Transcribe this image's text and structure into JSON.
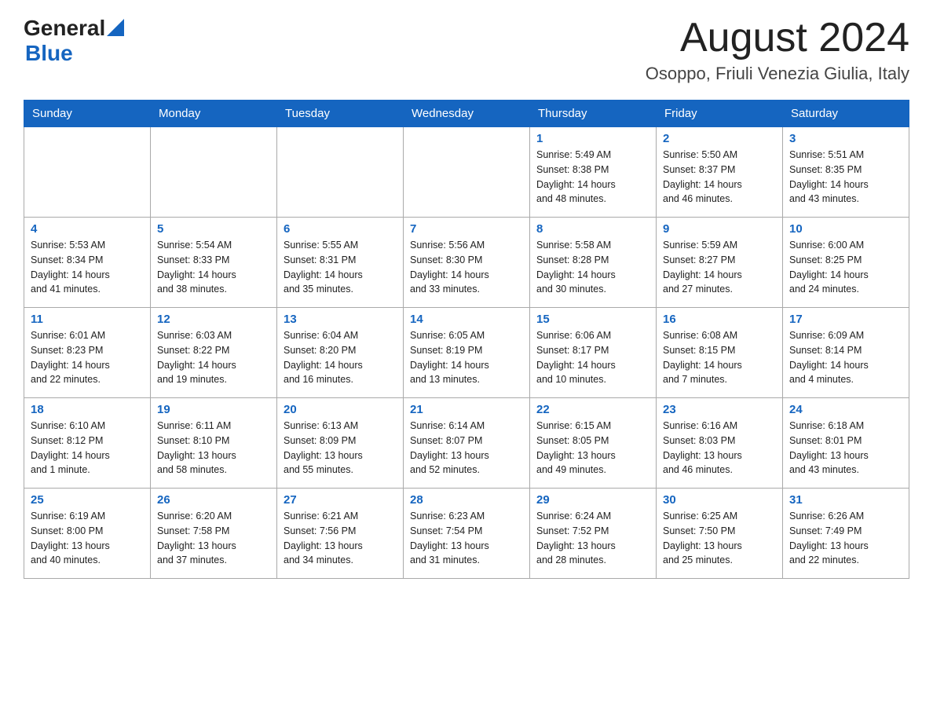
{
  "header": {
    "logo_general": "General",
    "logo_blue": "Blue",
    "month_title": "August 2024",
    "subtitle": "Osoppo, Friuli Venezia Giulia, Italy"
  },
  "days_of_week": [
    "Sunday",
    "Monday",
    "Tuesday",
    "Wednesday",
    "Thursday",
    "Friday",
    "Saturday"
  ],
  "weeks": [
    [
      {
        "day": "",
        "info": ""
      },
      {
        "day": "",
        "info": ""
      },
      {
        "day": "",
        "info": ""
      },
      {
        "day": "",
        "info": ""
      },
      {
        "day": "1",
        "info": "Sunrise: 5:49 AM\nSunset: 8:38 PM\nDaylight: 14 hours\nand 48 minutes."
      },
      {
        "day": "2",
        "info": "Sunrise: 5:50 AM\nSunset: 8:37 PM\nDaylight: 14 hours\nand 46 minutes."
      },
      {
        "day": "3",
        "info": "Sunrise: 5:51 AM\nSunset: 8:35 PM\nDaylight: 14 hours\nand 43 minutes."
      }
    ],
    [
      {
        "day": "4",
        "info": "Sunrise: 5:53 AM\nSunset: 8:34 PM\nDaylight: 14 hours\nand 41 minutes."
      },
      {
        "day": "5",
        "info": "Sunrise: 5:54 AM\nSunset: 8:33 PM\nDaylight: 14 hours\nand 38 minutes."
      },
      {
        "day": "6",
        "info": "Sunrise: 5:55 AM\nSunset: 8:31 PM\nDaylight: 14 hours\nand 35 minutes."
      },
      {
        "day": "7",
        "info": "Sunrise: 5:56 AM\nSunset: 8:30 PM\nDaylight: 14 hours\nand 33 minutes."
      },
      {
        "day": "8",
        "info": "Sunrise: 5:58 AM\nSunset: 8:28 PM\nDaylight: 14 hours\nand 30 minutes."
      },
      {
        "day": "9",
        "info": "Sunrise: 5:59 AM\nSunset: 8:27 PM\nDaylight: 14 hours\nand 27 minutes."
      },
      {
        "day": "10",
        "info": "Sunrise: 6:00 AM\nSunset: 8:25 PM\nDaylight: 14 hours\nand 24 minutes."
      }
    ],
    [
      {
        "day": "11",
        "info": "Sunrise: 6:01 AM\nSunset: 8:23 PM\nDaylight: 14 hours\nand 22 minutes."
      },
      {
        "day": "12",
        "info": "Sunrise: 6:03 AM\nSunset: 8:22 PM\nDaylight: 14 hours\nand 19 minutes."
      },
      {
        "day": "13",
        "info": "Sunrise: 6:04 AM\nSunset: 8:20 PM\nDaylight: 14 hours\nand 16 minutes."
      },
      {
        "day": "14",
        "info": "Sunrise: 6:05 AM\nSunset: 8:19 PM\nDaylight: 14 hours\nand 13 minutes."
      },
      {
        "day": "15",
        "info": "Sunrise: 6:06 AM\nSunset: 8:17 PM\nDaylight: 14 hours\nand 10 minutes."
      },
      {
        "day": "16",
        "info": "Sunrise: 6:08 AM\nSunset: 8:15 PM\nDaylight: 14 hours\nand 7 minutes."
      },
      {
        "day": "17",
        "info": "Sunrise: 6:09 AM\nSunset: 8:14 PM\nDaylight: 14 hours\nand 4 minutes."
      }
    ],
    [
      {
        "day": "18",
        "info": "Sunrise: 6:10 AM\nSunset: 8:12 PM\nDaylight: 14 hours\nand 1 minute."
      },
      {
        "day": "19",
        "info": "Sunrise: 6:11 AM\nSunset: 8:10 PM\nDaylight: 13 hours\nand 58 minutes."
      },
      {
        "day": "20",
        "info": "Sunrise: 6:13 AM\nSunset: 8:09 PM\nDaylight: 13 hours\nand 55 minutes."
      },
      {
        "day": "21",
        "info": "Sunrise: 6:14 AM\nSunset: 8:07 PM\nDaylight: 13 hours\nand 52 minutes."
      },
      {
        "day": "22",
        "info": "Sunrise: 6:15 AM\nSunset: 8:05 PM\nDaylight: 13 hours\nand 49 minutes."
      },
      {
        "day": "23",
        "info": "Sunrise: 6:16 AM\nSunset: 8:03 PM\nDaylight: 13 hours\nand 46 minutes."
      },
      {
        "day": "24",
        "info": "Sunrise: 6:18 AM\nSunset: 8:01 PM\nDaylight: 13 hours\nand 43 minutes."
      }
    ],
    [
      {
        "day": "25",
        "info": "Sunrise: 6:19 AM\nSunset: 8:00 PM\nDaylight: 13 hours\nand 40 minutes."
      },
      {
        "day": "26",
        "info": "Sunrise: 6:20 AM\nSunset: 7:58 PM\nDaylight: 13 hours\nand 37 minutes."
      },
      {
        "day": "27",
        "info": "Sunrise: 6:21 AM\nSunset: 7:56 PM\nDaylight: 13 hours\nand 34 minutes."
      },
      {
        "day": "28",
        "info": "Sunrise: 6:23 AM\nSunset: 7:54 PM\nDaylight: 13 hours\nand 31 minutes."
      },
      {
        "day": "29",
        "info": "Sunrise: 6:24 AM\nSunset: 7:52 PM\nDaylight: 13 hours\nand 28 minutes."
      },
      {
        "day": "30",
        "info": "Sunrise: 6:25 AM\nSunset: 7:50 PM\nDaylight: 13 hours\nand 25 minutes."
      },
      {
        "day": "31",
        "info": "Sunrise: 6:26 AM\nSunset: 7:49 PM\nDaylight: 13 hours\nand 22 minutes."
      }
    ]
  ]
}
